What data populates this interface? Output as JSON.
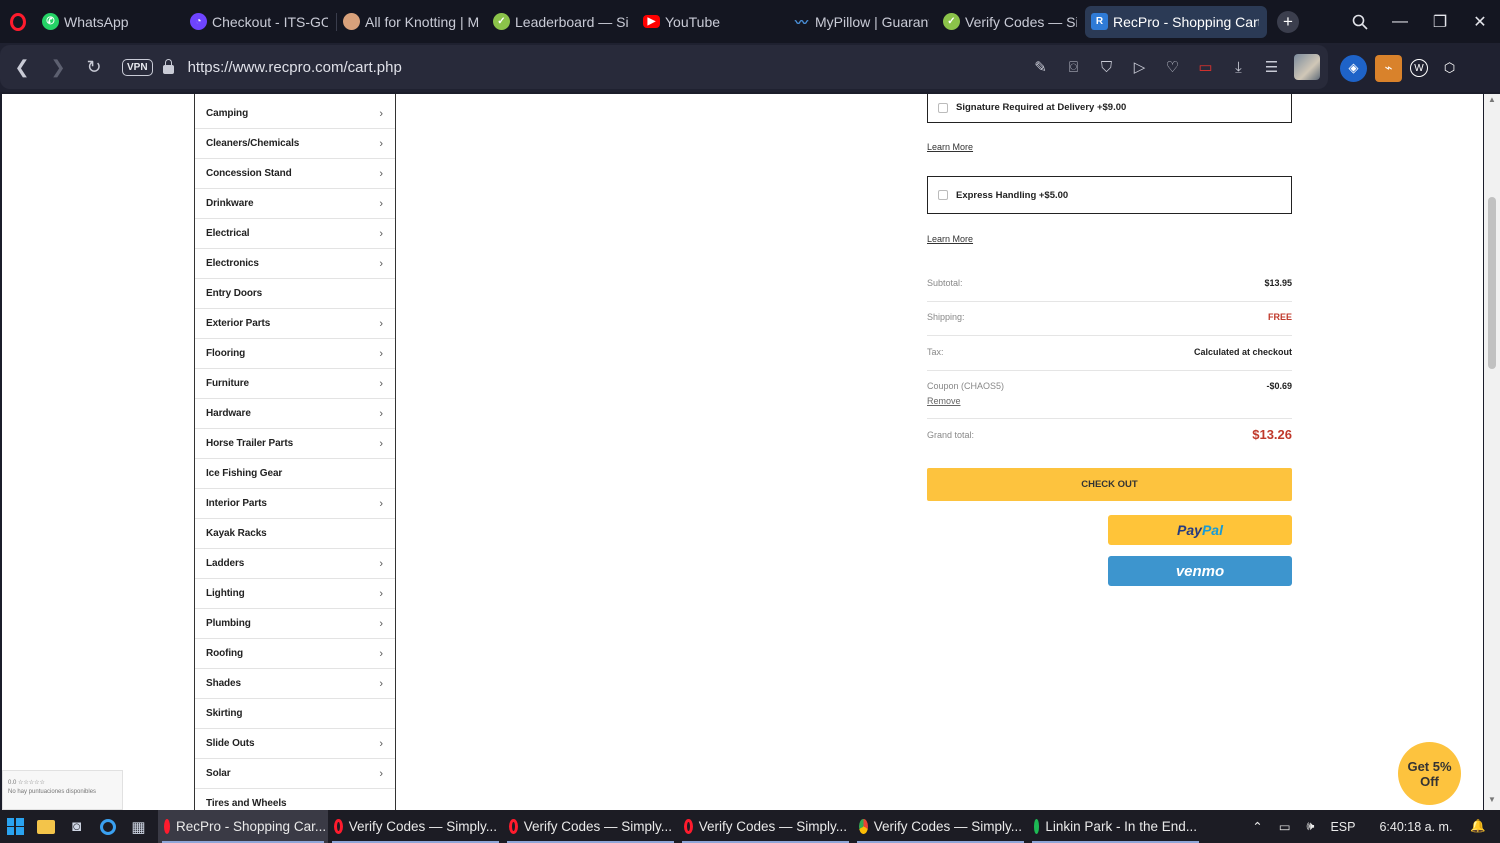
{
  "browser": {
    "tabs": [
      {
        "label": "WhatsApp",
        "icon": "whatsapp-icon",
        "color": "#25d366",
        "active": false
      },
      {
        "label": "Checkout - ITS-GOLF",
        "icon": "its-golf-icon",
        "color": "#6e44ff",
        "active": false
      },
      {
        "label": "All for Knotting | Ma",
        "icon": "knotting-icon",
        "color": "#d8a17b",
        "active": false
      },
      {
        "label": "Leaderboard — Simp",
        "icon": "simply-icon",
        "color": "#8bc34a",
        "active": false
      },
      {
        "label": "YouTube",
        "icon": "youtube-icon",
        "color": "#ff0000",
        "active": false
      },
      {
        "label": "MyPillow | Guarante",
        "icon": "mypillow-icon",
        "color": "#2f6db4",
        "active": false
      },
      {
        "label": "Verify Codes — Simp",
        "icon": "simply-icon",
        "color": "#8bc34a",
        "active": false
      },
      {
        "label": "RecPro - Shopping Cart",
        "icon": "recpro-icon",
        "color": "#2f7bd6",
        "active": true
      }
    ],
    "url": "https://www.recpro.com/cart.php",
    "vpn_label": "VPN"
  },
  "categories": [
    {
      "label": "Camping",
      "arrow": true
    },
    {
      "label": "Cleaners/Chemicals",
      "arrow": true
    },
    {
      "label": "Concession Stand",
      "arrow": true
    },
    {
      "label": "Drinkware",
      "arrow": true
    },
    {
      "label": "Electrical",
      "arrow": true
    },
    {
      "label": "Electronics",
      "arrow": true
    },
    {
      "label": "Entry Doors",
      "arrow": false
    },
    {
      "label": "Exterior Parts",
      "arrow": true
    },
    {
      "label": "Flooring",
      "arrow": true
    },
    {
      "label": "Furniture",
      "arrow": true
    },
    {
      "label": "Hardware",
      "arrow": true
    },
    {
      "label": "Horse Trailer Parts",
      "arrow": true
    },
    {
      "label": "Ice Fishing Gear",
      "arrow": false
    },
    {
      "label": "Interior Parts",
      "arrow": true
    },
    {
      "label": "Kayak Racks",
      "arrow": false
    },
    {
      "label": "Ladders",
      "arrow": true
    },
    {
      "label": "Lighting",
      "arrow": true
    },
    {
      "label": "Plumbing",
      "arrow": true
    },
    {
      "label": "Roofing",
      "arrow": true
    },
    {
      "label": "Shades",
      "arrow": true
    },
    {
      "label": "Skirting",
      "arrow": false
    },
    {
      "label": "Slide Outs",
      "arrow": true
    },
    {
      "label": "Solar",
      "arrow": true
    },
    {
      "label": "Tires and Wheels",
      "arrow": false
    }
  ],
  "cart": {
    "signature_option": "Signature Required at Delivery +$9.00",
    "express_option": "Express Handling +$5.00",
    "learn_more": "Learn More",
    "subtotal_label": "Subtotal:",
    "subtotal_value": "$13.95",
    "shipping_label": "Shipping:",
    "shipping_value": "FREE",
    "tax_label": "Tax:",
    "tax_value": "Calculated at checkout",
    "coupon_label": "Coupon (CHAOS5)",
    "coupon_value": "-$0.69",
    "remove_label": "Remove",
    "grand_label": "Grand total:",
    "grand_value": "$13.26",
    "checkout_label": "CHECK OUT",
    "paypal_a": "Pay",
    "paypal_b": "Pal",
    "venmo_label": "venmo",
    "promo_line1": "Get 5%",
    "promo_line2": "Off",
    "rating_line1": "0.0 ☆☆☆☆☆",
    "rating_line2": "No hay puntuaciones disponibles",
    "accent": "#fdc33e",
    "price_red": "#c0392b"
  },
  "taskbar": {
    "apps": [
      {
        "label": "RecPro - Shopping Car...",
        "active": true
      },
      {
        "label": "Verify Codes — Simply...",
        "active": false
      },
      {
        "label": "Verify Codes — Simply...",
        "active": false
      },
      {
        "label": "Verify Codes — Simply...",
        "active": false
      },
      {
        "label": "Verify Codes — Simply...",
        "active": false
      },
      {
        "label": "Linkin Park - In the End...",
        "active": false
      }
    ],
    "lang": "ESP",
    "time": "6:40:18 a. m."
  }
}
